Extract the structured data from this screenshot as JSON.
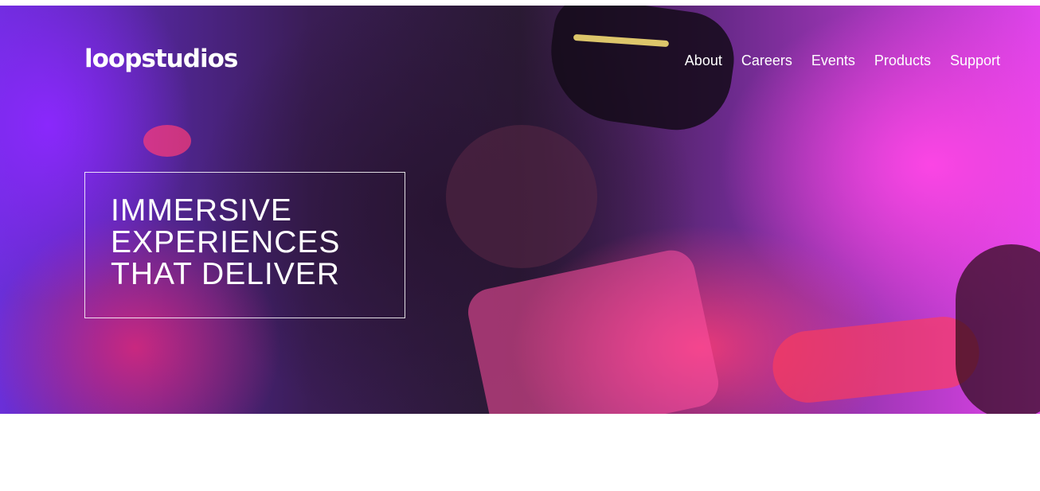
{
  "brand": {
    "logo_text": "loopstudios"
  },
  "nav": {
    "items": [
      {
        "label": "About"
      },
      {
        "label": "Careers"
      },
      {
        "label": "Events"
      },
      {
        "label": "Products"
      },
      {
        "label": "Support"
      }
    ]
  },
  "hero": {
    "headline_lines": [
      "IMMERSIVE",
      "EXPERIENCES",
      "THAT DELIVER"
    ]
  },
  "colors": {
    "text": "#ffffff",
    "hero_accent_magenta": "#e044ea",
    "hero_accent_violet": "#6a2fd8",
    "hero_dark": "#2a1a33"
  }
}
